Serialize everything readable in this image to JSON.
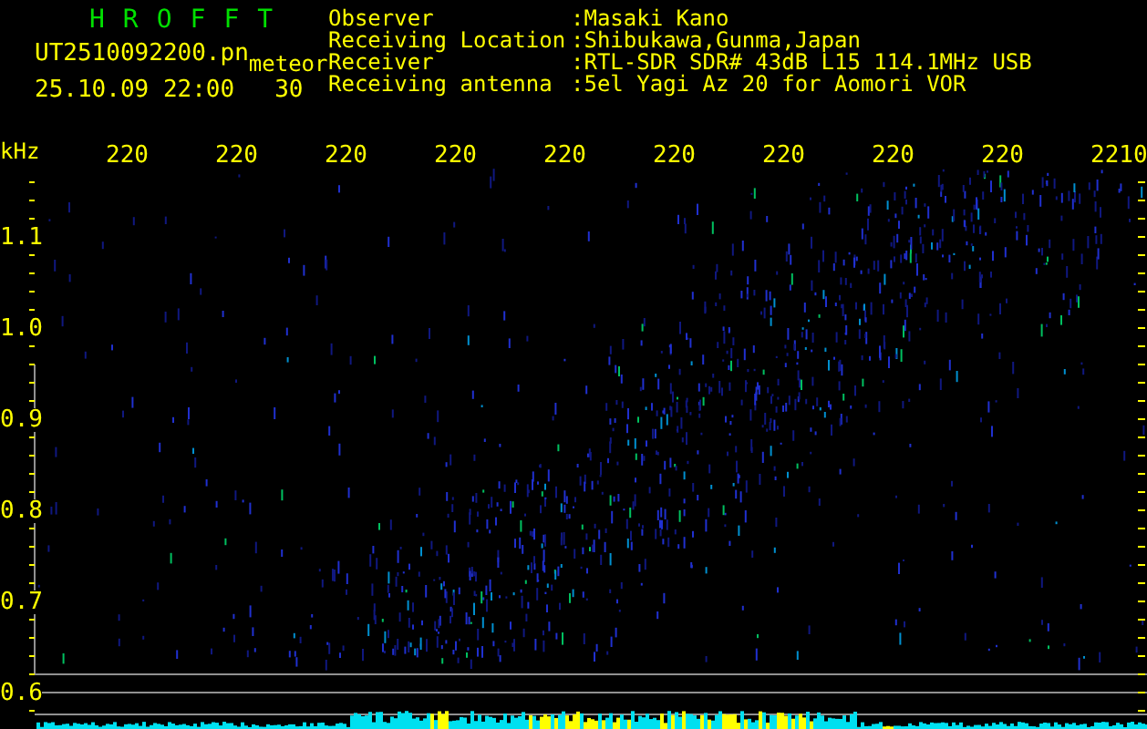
{
  "app": {
    "title": "HROFFT"
  },
  "file": {
    "name": "UT2510092200.pn",
    "datetime": "25.10.09 22:00"
  },
  "meteor": {
    "label": "meteor",
    "count": "30"
  },
  "info": [
    {
      "label": "Observer",
      "value": ":Masaki Kano"
    },
    {
      "label": "Receiving Location",
      "value": ":Shibukawa,Gunma,Japan"
    },
    {
      "label": "Receiver",
      "value": ":RTL-SDR SDR# 43dB L15 114.1MHz USB"
    },
    {
      "label": "Receiving antenna",
      "value": ":5el Yagi Az 20 for Aomori VOR"
    }
  ],
  "spectrogram": {
    "unit": "kHz",
    "time_ticks": [
      "220",
      "220",
      "220",
      "220",
      "220",
      "220",
      "220",
      "220",
      "220",
      "2210"
    ],
    "freq_ticks": [
      "1.1",
      "1.0",
      "0.9",
      "0.8",
      "0.7",
      "0.6"
    ]
  }
}
